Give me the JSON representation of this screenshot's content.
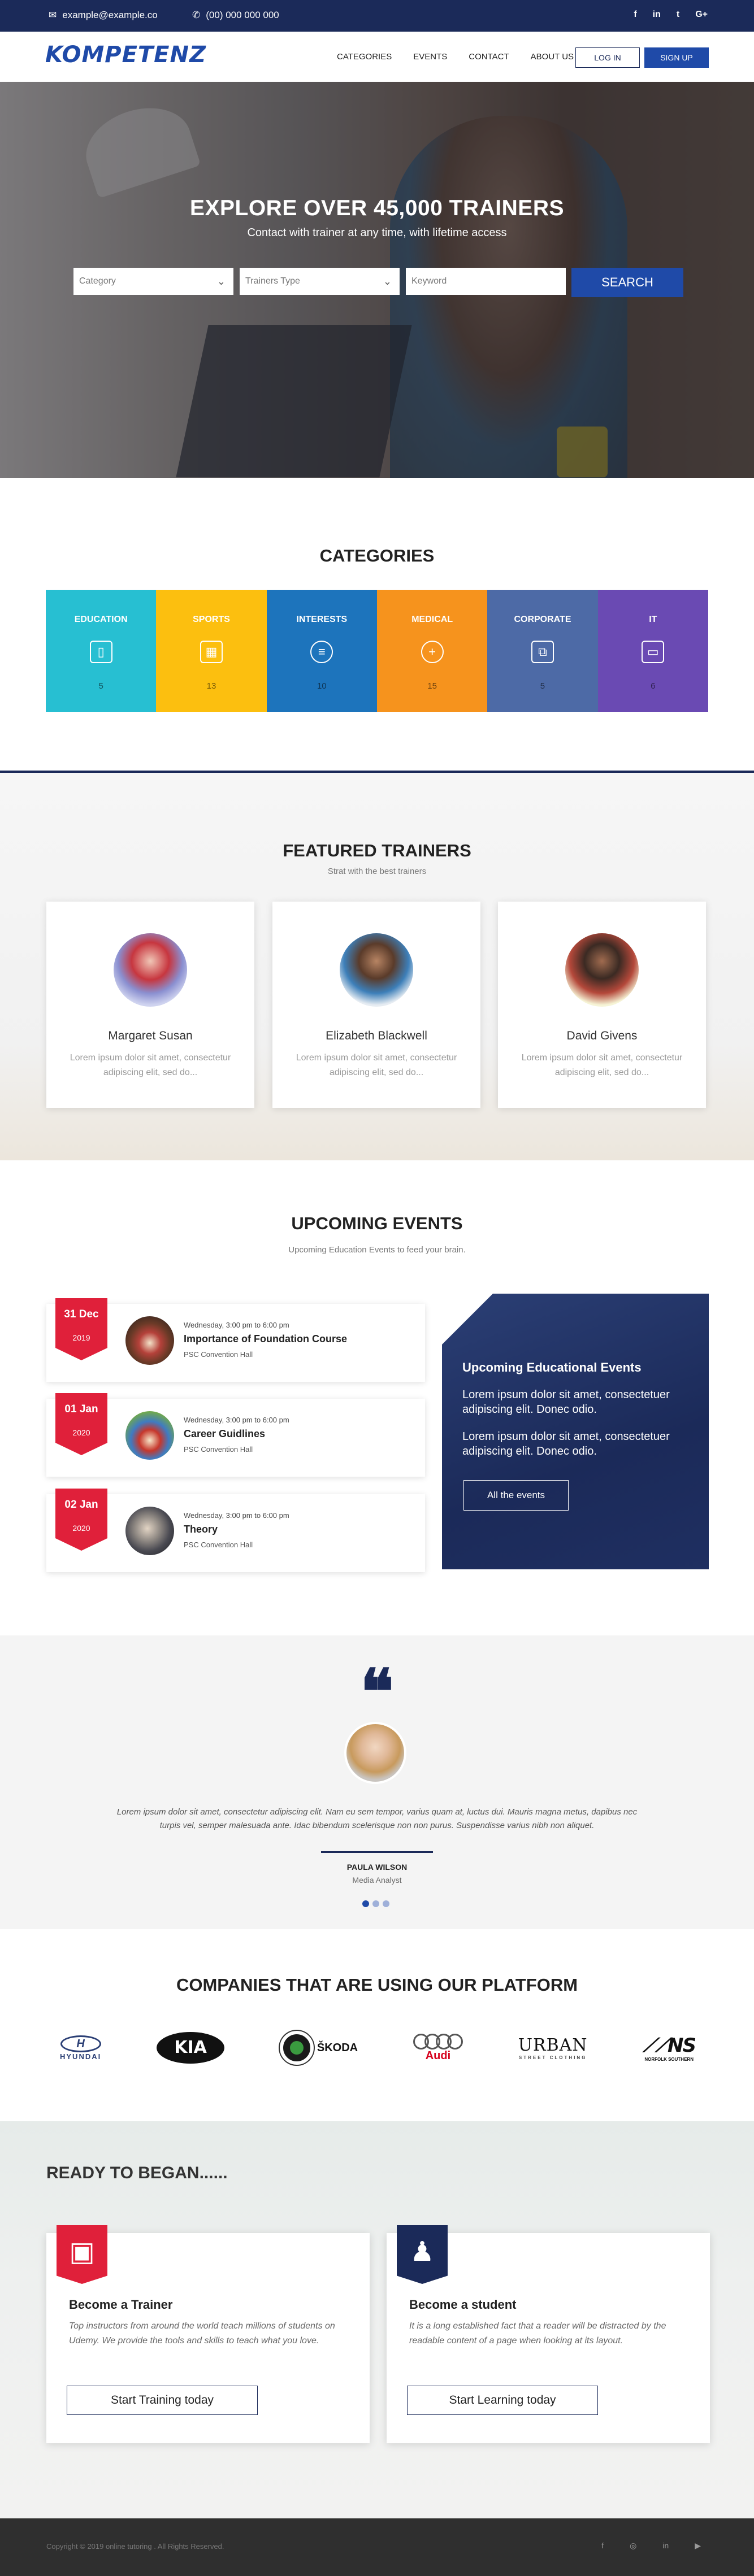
{
  "topbar": {
    "email": "example@example.co",
    "phone": "(00) 000 000 000",
    "social": [
      "f",
      "in",
      "t",
      "G+"
    ]
  },
  "nav": {
    "logo": "KOMPETENZ",
    "menu": [
      "CATEGORIES",
      "EVENTS",
      "CONTACT",
      "ABOUT US"
    ],
    "login": "LOG IN",
    "signup": "SIGN UP"
  },
  "hero": {
    "title": "EXPLORE OVER 45,000 TRAINERS",
    "subtitle": "Contact with trainer at any time, with lifetime access",
    "category_value": "Category",
    "type_value": "Trainers Type",
    "keyword_placeholder": "Keyword",
    "search_label": "SEARCH"
  },
  "categories": {
    "title": "CATEGORIES",
    "items": [
      {
        "label": "EDUCATION",
        "count": "5",
        "color": "#27bfd2",
        "icon": "phone-icon",
        "glyph": "▯"
      },
      {
        "label": "SPORTS",
        "count": "13",
        "color": "#fcbf0f",
        "icon": "calculator-icon",
        "glyph": "▦"
      },
      {
        "label": "INTERESTS",
        "count": "10",
        "color": "#1d74bc",
        "icon": "list-circle-icon",
        "glyph": "≡"
      },
      {
        "label": "MEDICAL",
        "count": "15",
        "color": "#f6931d",
        "icon": "plus-circle-icon",
        "glyph": "+"
      },
      {
        "label": "CORPORATE",
        "count": "5",
        "color": "#4d6aa6",
        "icon": "briefcase-icon",
        "glyph": "⧉"
      },
      {
        "label": "IT",
        "count": "6",
        "color": "#6a4ab3",
        "icon": "devices-icon",
        "glyph": "▭"
      }
    ]
  },
  "trainers": {
    "title": "FEATURED TRAINERS",
    "subtitle": "Strat with the best trainers",
    "items": [
      {
        "name": "Margaret Susan",
        "desc": "Lorem ipsum dolor sit amet, consectetur adipiscing elit, sed do..."
      },
      {
        "name": "Elizabeth Blackwell",
        "desc": "Lorem ipsum dolor sit amet, consectetur adipiscing elit, sed do..."
      },
      {
        "name": "David Givens",
        "desc": "Lorem ipsum dolor sit amet, consectetur adipiscing elit, sed do..."
      }
    ]
  },
  "events": {
    "title": "UPCOMING EVENTS",
    "subtitle": "Upcoming Education Events to feed your brain.",
    "items": [
      {
        "date": "31 Dec",
        "year": "2019",
        "time": "Wednesday, 3:00 pm to 6:00 pm",
        "name": "Importance of Foundation Course",
        "location": "PSC Convention Hall"
      },
      {
        "date": "01 Jan",
        "year": "2020",
        "time": "Wednesday, 3:00 pm to 6:00 pm",
        "name": "Career Guidlines",
        "location": "PSC Convention Hall"
      },
      {
        "date": "02 Jan",
        "year": "2020",
        "time": "Wednesday, 3:00 pm to 6:00 pm",
        "name": "Theory",
        "location": "PSC Convention Hall"
      }
    ],
    "panel": {
      "title": "Upcoming Educational Events",
      "p1": "Lorem ipsum dolor sit amet, consectetuer adipiscing elit. Donec odio.",
      "p2": "Lorem ipsum dolor sit amet, consectetuer adipiscing elit. Donec odio.",
      "button": "All the events"
    }
  },
  "testimonial": {
    "quote": "Lorem ipsum dolor sit amet, consectetur adipiscing elit. Nam eu sem tempor, varius quam at, luctus dui. Mauris magna metus, dapibus nec turpis vel, semper malesuada ante. Idac bibendum scelerisque non non purus. Suspendisse varius nibh non aliquet.",
    "name": "PAULA WILSON",
    "role": "Media Analyst"
  },
  "companies": {
    "title": "COMPANIES THAT ARE USING OUR PLATFORM",
    "logos": [
      "HYUNDAI",
      "KIA",
      "ŠKODA",
      "Audi",
      "URBAN",
      "NS"
    ]
  },
  "ready": {
    "title": "READY TO BEGAN......",
    "cards": [
      {
        "title": "Become a Trainer",
        "desc": "Top instructors from around the world teach millions of students on Udemy. We provide the tools and skills to teach what you love.",
        "button": "Start Training today",
        "color": "#e0203a"
      },
      {
        "title": "Become a student",
        "desc": "It is a long established fact that a reader will be distracted by the readable content of a page when looking at its layout.",
        "button": "Start Learning today",
        "color": "#1b2a59"
      }
    ]
  },
  "footer": {
    "copyright": "Copyright © 2019 online tutoring . All Rights Reserved.",
    "social": [
      "f",
      "◎",
      "in",
      "▶"
    ]
  }
}
